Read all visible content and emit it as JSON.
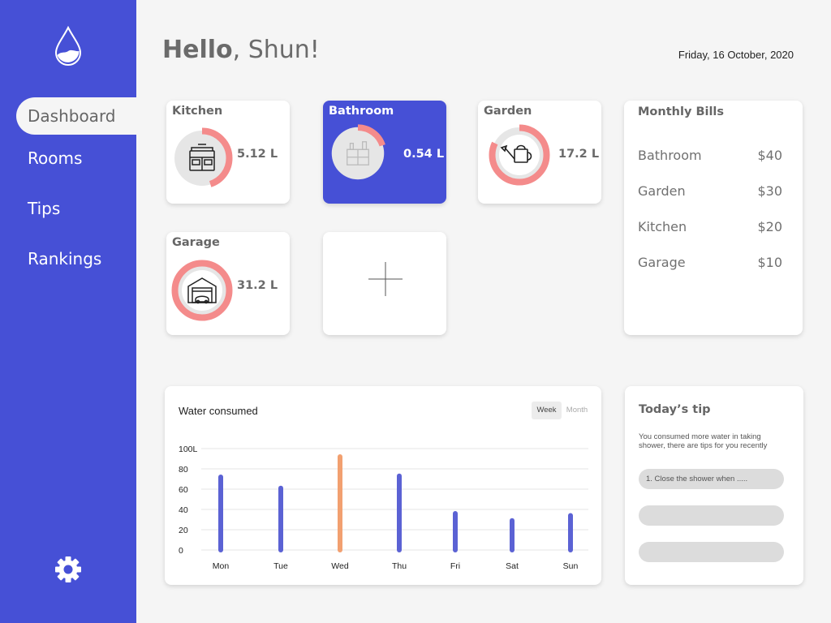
{
  "app": {
    "logo_icon": "water-drop-icon"
  },
  "sidebar": {
    "items": [
      {
        "label": "Dashboard",
        "active": true
      },
      {
        "label": "Rooms"
      },
      {
        "label": "Tips"
      },
      {
        "label": "Rankings"
      }
    ],
    "settings_icon": "gear-icon"
  },
  "header": {
    "hello": "Hello",
    "name": ", Shun!",
    "date": "Friday, 16 October, 2020"
  },
  "rooms": [
    {
      "name": "Kitchen",
      "usage": "5.12 L",
      "progress": 0.45,
      "icon": "stove-icon"
    },
    {
      "name": "Bathroom",
      "usage": "0.54 L",
      "progress": 0.2,
      "icon": "bathroom-cabinet-icon"
    },
    {
      "name": "Garden",
      "usage": "17.2 L",
      "progress": 0.82,
      "icon": "watering-can-icon"
    },
    {
      "name": "Garage",
      "usage": "31.2 L",
      "progress": 1.0,
      "icon": "garage-icon"
    }
  ],
  "add_room_icon": "plus-icon",
  "bills": {
    "title": "Monthly Bills",
    "items": [
      {
        "room": "Bathroom",
        "amount": "$40"
      },
      {
        "room": "Garden",
        "amount": "$30"
      },
      {
        "room": "Kitchen",
        "amount": "$20"
      },
      {
        "room": "Garage",
        "amount": "$10"
      }
    ]
  },
  "consumption": {
    "title": "Water consumed",
    "toggle": {
      "week": "Week",
      "month": "Month",
      "selected": "Week"
    }
  },
  "chart_data": {
    "type": "bar",
    "categories": [
      "Mon",
      "Tue",
      "Wed",
      "Thu",
      "Fri",
      "Sat",
      "Sun"
    ],
    "values": [
      72,
      61,
      92,
      73,
      36,
      29,
      34
    ],
    "highlight": "Wed",
    "ylim": [
      0,
      100
    ],
    "yticks": [
      "100L",
      "80",
      "60",
      "40",
      "20",
      "0"
    ],
    "bar_color": "#5b62d4",
    "highlight_color": "#f2a070"
  },
  "tip": {
    "title": "Today’s tip",
    "text": "You consumed more water in taking shower, there are tips for you recently",
    "items": [
      "1. Close the shower when .....",
      "",
      ""
    ]
  },
  "colors": {
    "accent": "#4650d6",
    "ring": "#f48b8b",
    "ring_track": "#e6e6e6"
  }
}
